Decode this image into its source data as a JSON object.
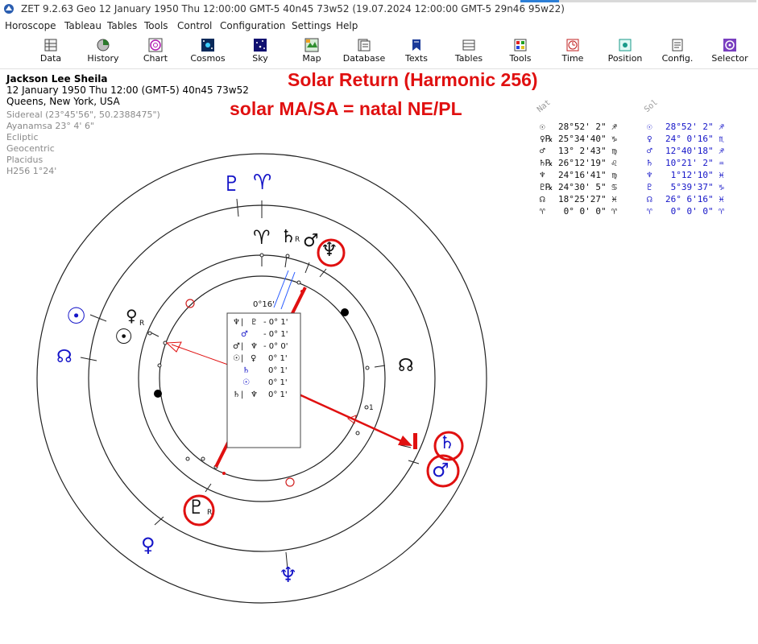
{
  "window": {
    "title": "ZET 9.2.63 Geo   12 January 1950  Thu  12:00:00 GMT-5 40n45  73w52  (19.07.2024  12:00:00 GMT-5 29n46 95w22)"
  },
  "menu": [
    "Horoscope",
    "Tableau",
    "Tables",
    "Tools",
    "Control",
    "Configuration",
    "Settings",
    "Help"
  ],
  "toolbar": [
    {
      "label": "Data",
      "icon": "data-icon"
    },
    {
      "label": "History",
      "icon": "history-icon"
    },
    {
      "label": "Chart",
      "icon": "chart-icon"
    },
    {
      "label": "Cosmos",
      "icon": "cosmos-icon"
    },
    {
      "label": "Sky",
      "icon": "sky-icon"
    },
    {
      "label": "Map",
      "icon": "map-icon"
    },
    {
      "label": "Database",
      "icon": "database-icon"
    },
    {
      "label": "Texts",
      "icon": "texts-icon"
    },
    {
      "label": "Tables",
      "icon": "tables-icon"
    },
    {
      "label": "Tools",
      "icon": "tools-icon"
    },
    {
      "label": "Time",
      "icon": "time-icon"
    },
    {
      "label": "Position",
      "icon": "position-icon"
    },
    {
      "label": "Config.",
      "icon": "config-icon"
    },
    {
      "label": "Selector",
      "icon": "selector-icon"
    }
  ],
  "info": {
    "name": "Jackson Lee Sheila",
    "date": "12 January 1950  Thu  12:00 (GMT-5) 40n45  73w52",
    "place": "Queens, New York, USA",
    "zodiac": "Sidereal (23°45'56\", 50.2388475\")",
    "ayanamsa": "Ayanamsa 23° 4' 6\"",
    "coords": "Ecliptic",
    "centric": "Geocentric",
    "houses": "Placidus",
    "harmonic": "H256    1°24'"
  },
  "headlines": {
    "line1": "Solar Return (Harmonic 256)",
    "line2": "solar MA/SA = natal NE/PL"
  },
  "positions": {
    "header_nat": "Nat",
    "header_sol": "Sol",
    "rows": [
      {
        "g_nat": "☉",
        "nat": "28°52' 2\" ♐",
        "g_sol": "☉",
        "sol": "28°52' 2\" ♐"
      },
      {
        "g_nat": "♀℞",
        "nat": "25°34'40\" ♑",
        "g_sol": "♀",
        "sol": "24° 0'16\" ♏"
      },
      {
        "g_nat": "♂",
        "nat": "13° 2'43\" ♍",
        "g_sol": "♂",
        "sol": "12°40'18\" ♐"
      },
      {
        "g_nat": "♄℞",
        "nat": "26°12'19\" ♌",
        "g_sol": "♄",
        "sol": "10°21' 2\" ♒"
      },
      {
        "g_nat": "♆",
        "nat": "24°16'41\" ♍",
        "g_sol": "♆",
        "sol": " 1°12'10\" ♓"
      },
      {
        "g_nat": "♇℞",
        "nat": "24°30' 5\" ♋",
        "g_sol": "♇",
        "sol": " 5°39'37\" ♑"
      },
      {
        "g_nat": "☊",
        "nat": "18°25'27\" ♓",
        "g_sol": "☊",
        "sol": "26° 6'16\" ♓"
      },
      {
        "g_nat": "♈",
        "nat": " 0° 0' 0\" ♈",
        "g_sol": "♈",
        "sol": " 0° 0' 0\" ♈"
      }
    ]
  },
  "aspect_box": {
    "top_label": "0°16'",
    "rows": [
      {
        "a": "♆",
        "b": "♇",
        "val": "- 0° 1'"
      },
      {
        "a": "♂",
        "b": "",
        "val": "- 0° 1'"
      },
      {
        "a": "♂",
        "b": "♆",
        "val": "- 0° 0'"
      },
      {
        "a": "☉",
        "b": "♀",
        "val": "0° 1'"
      },
      {
        "a": "♄",
        "b": "",
        "val": "0° 1'"
      },
      {
        "a": "☉",
        "b": "",
        "val": "0° 1'"
      },
      {
        "a": "♄",
        "b": "♆",
        "val": "0° 1'"
      }
    ]
  },
  "glyphs": {
    "outer_pluto": "♇",
    "outer_aries": "♈",
    "sol_sun": "☉",
    "sol_node": "☊",
    "sol_venus": "♀",
    "sol_neptune": "♆",
    "nat_aries": "♈",
    "nat_saturn": "♄",
    "nat_mars": "♂",
    "nat_neptune": "♆",
    "nat_venus": "♀",
    "nat_sun": "☉",
    "nat_node": "☊",
    "nat_pluto": "♇",
    "ring_saturn": "♄",
    "ring_mars": "♂",
    "retro": "R",
    "house_num": "1"
  },
  "colors": {
    "red": "#e01010",
    "blue": "#1515c8"
  }
}
